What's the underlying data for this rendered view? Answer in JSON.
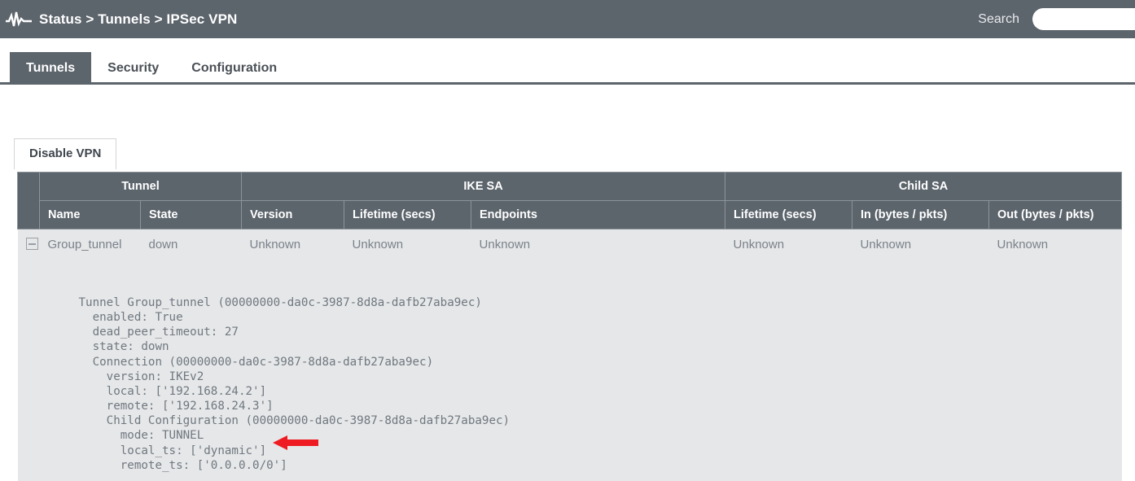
{
  "header": {
    "logo_icon": "waveform-icon",
    "breadcrumb": "Status > Tunnels > IPSec VPN",
    "search_label": "Search",
    "search_value": "",
    "search_placeholder": "",
    "bar_color": "#5c646c"
  },
  "tabs": [
    {
      "label": "Tunnels",
      "active": true
    },
    {
      "label": "Security",
      "active": false
    },
    {
      "label": "Configuration",
      "active": false
    }
  ],
  "toolbar": {
    "disable_vpn_label": "Disable VPN"
  },
  "table": {
    "group_headers": [
      {
        "label": "Tunnel",
        "span": 2
      },
      {
        "label": "IKE SA",
        "span": 3
      },
      {
        "label": "Child SA",
        "span": 3
      }
    ],
    "columns": [
      "Name",
      "State",
      "Version",
      "Lifetime (secs)",
      "Endpoints",
      "Lifetime (secs)",
      "In (bytes / pkts)",
      "Out (bytes / pkts)"
    ],
    "rows": [
      {
        "expander_icon": "collapse-minus-icon",
        "expanded": true,
        "cells": [
          "Group_tunnel",
          "down",
          "Unknown",
          "Unknown",
          "Unknown",
          "Unknown",
          "Unknown",
          "Unknown"
        ]
      }
    ],
    "detail_text": "Tunnel Group_tunnel (00000000-da0c-3987-8d8a-dafb27aba9ec)\n  enabled: True\n  dead_peer_timeout: 27\n  state: down\n  Connection (00000000-da0c-3987-8d8a-dafb27aba9ec)\n    version: IKEv2\n    local: ['192.168.24.2']\n    remote: ['192.168.24.3']\n    Child Configuration (00000000-da0c-3987-8d8a-dafb27aba9ec)\n      mode: TUNNEL\n      local_ts: ['dynamic']\n      remote_ts: ['0.0.0.0/0']",
    "header_bg": "#5c646c",
    "row_bg": "#e6e7e8",
    "text_color": "#7a828b"
  },
  "annotation": {
    "arrow_icon": "red-left-arrow-icon",
    "arrow_color": "#ee1c22",
    "points_at": "local_ts: ['dynamic']"
  }
}
